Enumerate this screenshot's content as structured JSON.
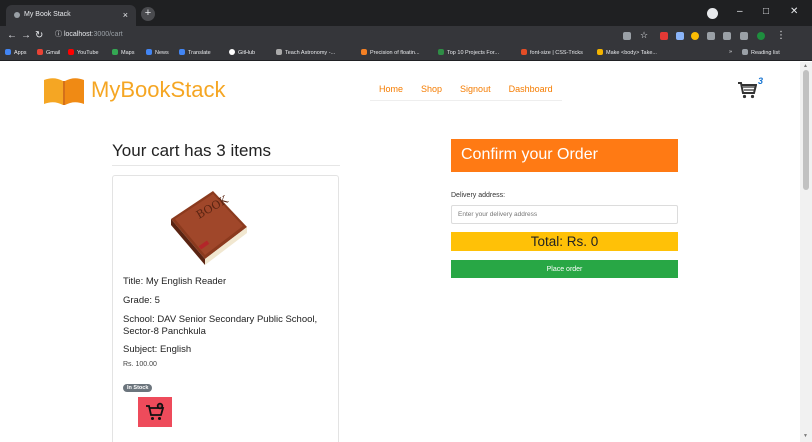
{
  "browser": {
    "tab_title": "My Book Stack",
    "tab_close": "×",
    "new_tab": "+",
    "url_host": "localhost",
    "url_path": ":3000/cart",
    "window_controls": [
      "–",
      "□",
      "✕"
    ],
    "bookmarks": [
      {
        "label": "Apps",
        "color": "#4285f4"
      },
      {
        "label": "Gmail",
        "color": "#ea4335"
      },
      {
        "label": "YouTube",
        "color": "#ff0000"
      },
      {
        "label": "Maps",
        "color": "#34a853"
      },
      {
        "label": "News",
        "color": "#4285f4"
      },
      {
        "label": "Translate",
        "color": "#4285f4"
      },
      {
        "label": "GitHub",
        "color": "#ffffff"
      },
      {
        "label": "Teach Astronomy -...",
        "color": "#aaaaaa"
      },
      {
        "label": "Precision of floatin...",
        "color": "#f48024"
      },
      {
        "label": "Top 10 Projects For...",
        "color": "#2f8d46"
      },
      {
        "label": "font-size | CSS-Tricks",
        "color": "#e44d26"
      },
      {
        "label": "Make <body> Take...",
        "color": "#f4b400"
      }
    ],
    "bookmarks_more": "»",
    "reading_list": "Reading list"
  },
  "site": {
    "brand": "MyBookStack",
    "nav": [
      "Home",
      "Shop",
      "Signout",
      "Dashboard"
    ],
    "cart_count": "3",
    "accent": "#f57c00"
  },
  "cart": {
    "heading": "Your cart has 3 items",
    "item": {
      "title": "Title: My English Reader",
      "grade": "Grade: 5",
      "school": "School: DAV Senior Secondary Public School, Sector-8 Panchkula",
      "subject": "Subject: English",
      "price": "Rs. 100.00",
      "stock": "In Stock",
      "image_icon": "book-icon",
      "add_icon": "cart-plus-icon"
    }
  },
  "order": {
    "confirm_title": "Confirm your Order",
    "address_label": "Delivery address:",
    "address_placeholder": "Enter your delivery address",
    "address_value": "",
    "total": "Total: Rs. 0",
    "place_order": "Place order"
  }
}
